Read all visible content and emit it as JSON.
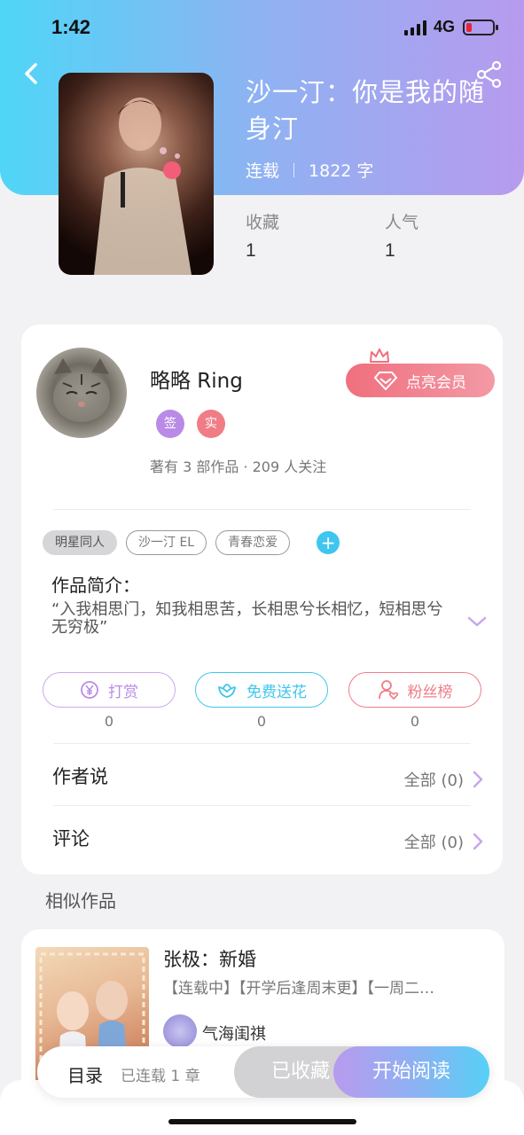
{
  "status_bar": {
    "time": "1:42",
    "network": "4G",
    "battery_color": "#e3263a"
  },
  "book": {
    "title": "沙一汀：你是我的随身汀",
    "status": "连载",
    "word_count": "1822 字",
    "stats": [
      {
        "label": "收藏",
        "value": "1"
      },
      {
        "label": "人气",
        "value": "1"
      }
    ]
  },
  "author": {
    "name": "略略 Ring",
    "badges": [
      "签",
      "实"
    ],
    "meta": "著有 3 部作品 · 209 人关注",
    "vip_label": "点亮会员"
  },
  "tags": [
    "明星同人",
    "沙一汀 EL",
    "青春恋爱"
  ],
  "intro": {
    "label": "作品简介：",
    "text": "“入我相思门，知我相思苦，长相思兮长相忆，短相思兮无穷极”"
  },
  "actions": [
    {
      "label": "打赏",
      "count": "0",
      "icon": "yen-icon",
      "color": "#b98be6"
    },
    {
      "label": "免费送花",
      "count": "0",
      "icon": "flower-icon",
      "color": "#3ec6ee"
    },
    {
      "label": "粉丝榜",
      "count": "0",
      "icon": "fan-icon",
      "color": "#f07c86"
    }
  ],
  "rows": [
    {
      "label": "作者说",
      "value": "全部 (0)"
    },
    {
      "label": "评论",
      "value": "全部 (0)"
    }
  ],
  "similar": {
    "section_title": "相似作品",
    "items": [
      {
        "title": "张极：新婚",
        "desc": "【连载中】【开学后逢周末更】【一周二…",
        "author": "气海闺祺"
      }
    ]
  },
  "bottom_bar": {
    "toc_label": "目录",
    "toc_count": "已连载 1 章",
    "favorite_label": "已收藏",
    "read_label": "开始阅读"
  },
  "colors": {
    "accent_purple": "#b89bee",
    "accent_cyan": "#56d0f6",
    "vip_pink": "#f06f7e"
  }
}
